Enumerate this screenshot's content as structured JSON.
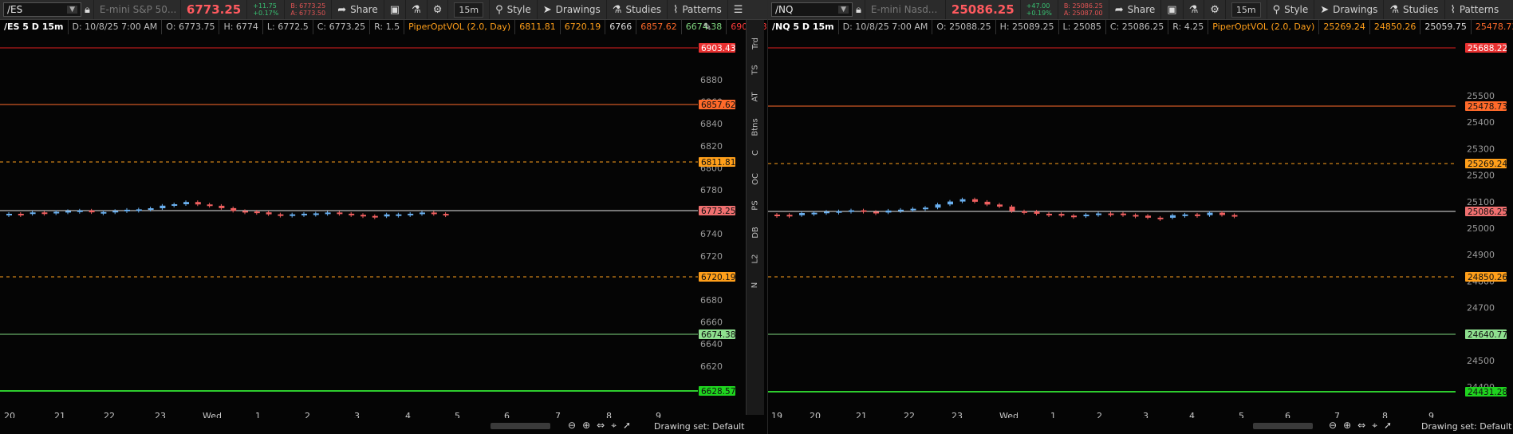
{
  "left": {
    "symbol": "/ES",
    "description": "E-mini S&P 50...",
    "last": "6773.25",
    "change": "+11.75",
    "change_pct": "+0.17%",
    "bid": "B: 6773.25",
    "ask": "A: 6773.50",
    "toolbar": {
      "share": "Share",
      "timeframe": "15m",
      "style": "Style",
      "drawings": "Drawings",
      "studies": "Studies",
      "patterns": "Patterns"
    },
    "info": {
      "title": "/ES 5 D 15m",
      "date": "D: 10/8/25 7:00 AM",
      "open": "O: 6773.75",
      "high": "H: 6774",
      "low": "L: 6772.5",
      "close": "C: 6773.25",
      "range": "R: 1.5",
      "study": "PiperOptVOL (2.0, Day)",
      "values": [
        "6811.81",
        "6720.19",
        "6766",
        "6857.62",
        "6674.38",
        "6903.43",
        "..."
      ]
    },
    "price_labels": [
      "6880",
      "6860",
      "6840",
      "6820",
      "6800",
      "6780",
      "6760",
      "6740",
      "6720",
      "6700",
      "6680",
      "6660",
      "6640",
      "6620"
    ],
    "levels": [
      {
        "label": "6903.43",
        "line": "#e02020",
        "box": "#e83030",
        "text": "#fff"
      },
      {
        "label": "6857.62",
        "line": "#ff6a2a",
        "box": "#ff6a2a",
        "text": "#111"
      },
      {
        "label": "6811.81",
        "line": "#ff9f1a",
        "box": "#ff9f1a",
        "text": "#111"
      },
      {
        "label": "6773.25",
        "line": "#e8e8e8",
        "box": "#f07070",
        "text": "#111"
      },
      {
        "label": "6720.19",
        "line": "#ff9f1a",
        "box": "#ff9f1a",
        "text": "#111"
      },
      {
        "label": "6674.38",
        "line": "#7fd67f",
        "box": "#8fe08f",
        "text": "#111"
      },
      {
        "label": "6628.57",
        "line": "#2ecc2e",
        "box": "#1fd41f",
        "text": "#111"
      }
    ],
    "time_labels": [
      "20",
      "21",
      "22",
      "23",
      "Wed",
      "1",
      "2",
      "3",
      "4",
      "5",
      "6",
      "7",
      "8",
      "9"
    ],
    "drawing_set": "Drawing set: Default",
    "vtabs": [
      "Trd",
      "TS",
      "AT",
      "Btns",
      "C",
      "OC",
      "PS",
      "DB",
      "L2",
      "N"
    ]
  },
  "right": {
    "symbol": "/NQ",
    "description": "E-mini Nasd...",
    "last": "25086.25",
    "change": "+47.00",
    "change_pct": "+0.19%",
    "bid": "B: 25086.25",
    "ask": "A: 25087.00",
    "toolbar": {
      "share": "Share",
      "timeframe": "15m",
      "style": "Style",
      "drawings": "Drawings",
      "studies": "Studies",
      "patterns": "Patterns"
    },
    "info": {
      "title": "/NQ 5 D 15m",
      "date": "D: 10/8/25 7:00 AM",
      "open": "O: 25088.25",
      "high": "H: 25089.25",
      "low": "L: 25085",
      "close": "C: 25086.25",
      "range": "R: 4.25",
      "study": "PiperOptVOL (2.0, Day)",
      "values": [
        "25269.24",
        "24850.26",
        "25059.75",
        "25478.73",
        "..."
      ]
    },
    "price_labels": [
      "25500",
      "25400",
      "25300",
      "25200",
      "25100",
      "25000",
      "24900",
      "24800",
      "24700",
      "24600",
      "24500",
      "24400"
    ],
    "levels": [
      {
        "label": "25688.22",
        "line": "#e02020",
        "box": "#e83030",
        "text": "#fff"
      },
      {
        "label": "25478.73",
        "line": "#ff6a2a",
        "box": "#ff6a2a",
        "text": "#111"
      },
      {
        "label": "25269.24",
        "line": "#ff9f1a",
        "box": "#ff9f1a",
        "text": "#111"
      },
      {
        "label": "25086.25",
        "line": "#e8e8e8",
        "box": "#f07070",
        "text": "#111"
      },
      {
        "label": "24850.26",
        "line": "#ff9f1a",
        "box": "#ff9f1a",
        "text": "#111"
      },
      {
        "label": "24640.77",
        "line": "#7fd67f",
        "box": "#8fe08f",
        "text": "#111"
      },
      {
        "label": "24431.28",
        "line": "#2ecc2e",
        "box": "#1fd41f",
        "text": "#111"
      }
    ],
    "time_labels": [
      "19",
      "20",
      "21",
      "22",
      "23",
      "Wed",
      "1",
      "2",
      "3",
      "4",
      "5",
      "6",
      "7",
      "8",
      "9"
    ],
    "drawing_set": "Drawing set: Default"
  },
  "colors": {
    "up": "#6ab0f0",
    "down": "#f06060",
    "accent": "#ff9f1a"
  },
  "icons": [
    "lock-icon",
    "share-icon",
    "calendar-icon",
    "flask-icon",
    "gear-icon",
    "style-icon",
    "cursor-icon",
    "studies-icon",
    "patterns-icon",
    "menu-icon",
    "edit-icon",
    "zoom-out-icon",
    "zoom-in-icon",
    "pan-icon",
    "crosshair-icon",
    "pointer-icon"
  ]
}
